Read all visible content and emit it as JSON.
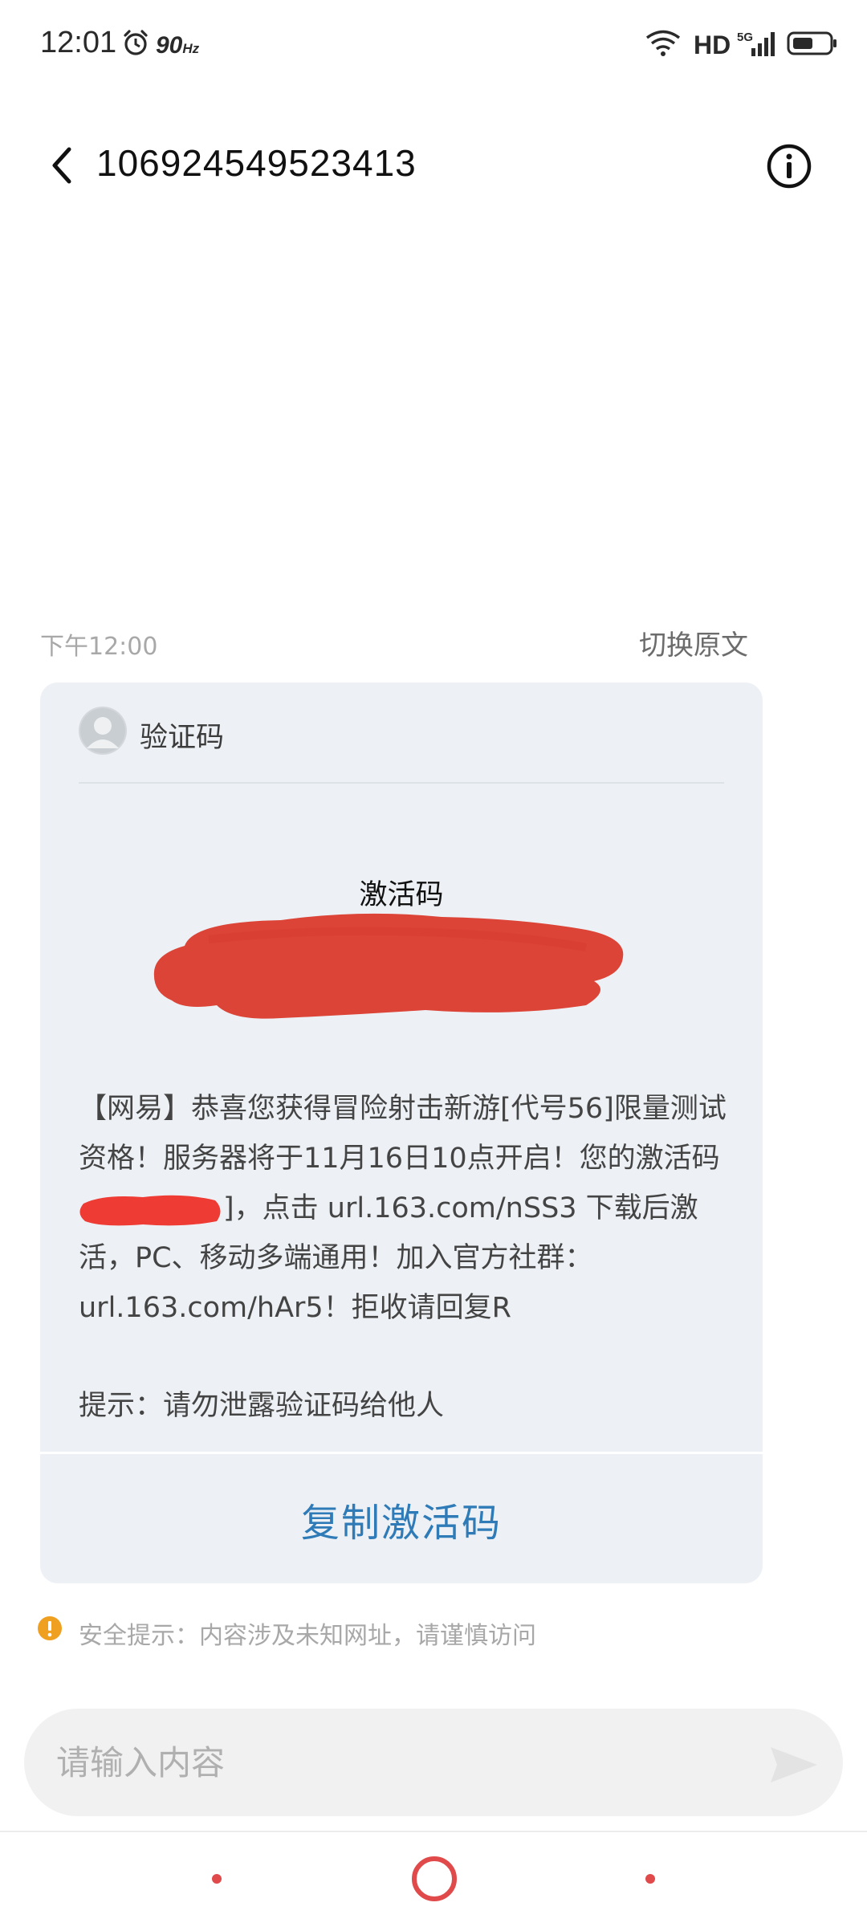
{
  "status_bar": {
    "time": "12:01",
    "refresh_rate": "90",
    "refresh_unit": "Hz",
    "hd": "HD",
    "network": "5G",
    "icons": [
      "alarm-icon",
      "wifi-icon",
      "signal-icon",
      "battery-icon"
    ]
  },
  "header": {
    "title": "106924549523413",
    "icons": [
      "back-icon",
      "info-icon"
    ]
  },
  "message": {
    "time": "下午12:00",
    "switch_label": "切换原文"
  },
  "card": {
    "sender": "验证码",
    "code_label": "激活码",
    "body_part1": "【网易】恭喜您获得冒险射击新游[代号56]限量测试资格！服务器将于11月16日10点开启！您的激活码",
    "body_part2": "]，点击 url.163.com/nSS3 下载后激活，PC、移动多端通用！加入官方社群：url.163.com/hAr5！拒收请回复R",
    "hint": "提示：请勿泄露验证码给他人",
    "copy_label": "复制激活码"
  },
  "safety": {
    "text": "安全提示：内容涉及未知网址，请谨慎访问"
  },
  "input": {
    "placeholder": "请输入内容",
    "value": ""
  },
  "colors": {
    "accent_blue": "#2e7bb8",
    "warning_orange": "#f0a020",
    "redaction_red": "#dc4437",
    "card_bg": "#edf1f5",
    "nav_red": "#e04a4a"
  }
}
